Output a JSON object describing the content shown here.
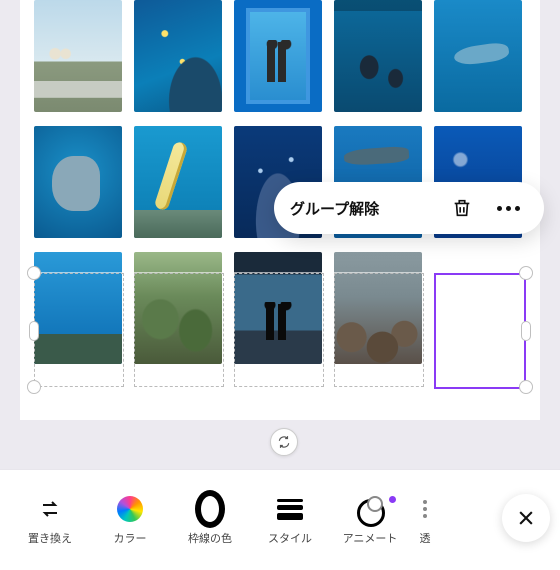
{
  "context_menu": {
    "ungroup_label": "グループ解除",
    "delete_name": "delete",
    "more_name": "more-options"
  },
  "toolbar": {
    "items": [
      {
        "id": "replace",
        "label": "置き換え"
      },
      {
        "id": "color",
        "label": "カラー"
      },
      {
        "id": "border_color",
        "label": "枠線の色"
      },
      {
        "id": "style",
        "label": "スタイル"
      },
      {
        "id": "animate",
        "label": "アニメート"
      },
      {
        "id": "transparency",
        "label": "透"
      }
    ],
    "close_name": "close"
  },
  "grid": {
    "rows": [
      [
        "sky",
        "reef1",
        "frame",
        "tank",
        "dolphin"
      ],
      [
        "mola",
        "eel",
        "deep",
        "shark",
        "jelly"
      ],
      [
        "water",
        "plant",
        "view",
        "rocks",
        "blank"
      ]
    ]
  },
  "selection": {
    "selected_row_index": 2,
    "active_cell_index": 4
  }
}
